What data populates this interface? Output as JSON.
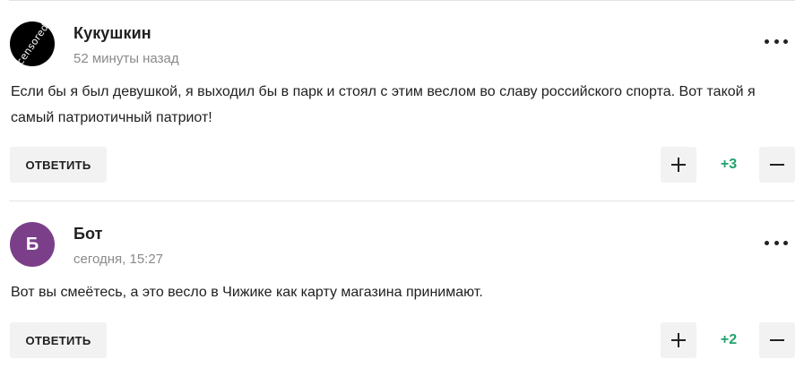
{
  "comments": [
    {
      "author": "Кукушкин",
      "time": "52 минуты назад",
      "avatar_text": "censored",
      "text": "Если бы я был девушкой, я выходил бы в парк и стоял с этим веслом во славу российского спорта. Вот такой я самый патриотичный патриот!",
      "reply_label": "ОТВЕТИТЬ",
      "score": "+3"
    },
    {
      "author": "Бот",
      "time": "сегодня, 15:27",
      "avatar_text": "Б",
      "avatar_color": "#7b3f8a",
      "text": "Вот вы смеётесь, а это весло в Чижике как карту магазина принимают.",
      "reply_label": "ОТВЕТИТЬ",
      "score": "+2"
    }
  ],
  "colors": {
    "score_positive": "#22a36b",
    "button_bg": "#f2f2f2",
    "meta_text": "#8a8a8a"
  },
  "icons": {
    "more": "more-dots-icon",
    "upvote": "plus-icon",
    "downvote": "minus-icon"
  }
}
